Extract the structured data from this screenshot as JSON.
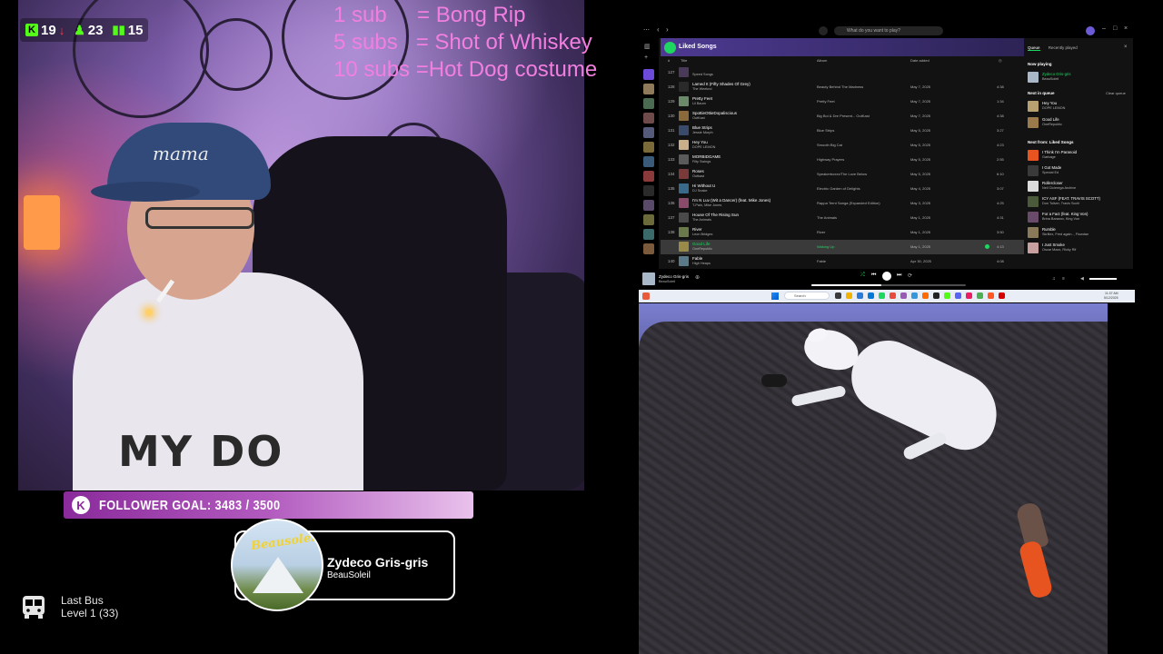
{
  "stats": {
    "kick_label": "K",
    "viewers_trend": "19",
    "followers": "23",
    "bars": "15"
  },
  "sub_goals": [
    {
      "count": "1 sub",
      "reward": "     = Bong Rip"
    },
    {
      "count": "5 subs",
      "reward": "   = Shot of Whiskey"
    },
    {
      "count": "10 subs",
      "reward": " =Hot Dog costume"
    }
  ],
  "follower_goal": {
    "logo": "K",
    "text": "FOLLOWER GOAL: 3483 / 3500",
    "current": 3483,
    "target": 3500
  },
  "now_playing": {
    "album_script": "Beausoleil",
    "title": "Zydeco Gris-gris",
    "artist": "BeauSoleil"
  },
  "last_bus": {
    "title": "Last Bus",
    "level": "Level 1  (33)",
    "icon": "bus-icon"
  },
  "webcam": {
    "cap_text": "mama",
    "shirt_text": "MY DO"
  },
  "spotify": {
    "search_placeholder": "What do you want to play?",
    "playlist_title": "Liked Songs",
    "columns": {
      "num": "#",
      "title": "Title",
      "album": "Album",
      "date": "Date added"
    },
    "rows": [
      {
        "num": "127",
        "title": "",
        "artist": "Speed Songs",
        "album": "",
        "date": "",
        "dur": ""
      },
      {
        "num": "128",
        "title": "Lamed It (Fifty Shades Of Grey)",
        "artist": "The Weeknd",
        "album": "Beauty Behind The Madness",
        "date": "May 7, 2025",
        "dur": "4:38"
      },
      {
        "num": "129",
        "title": "Pretty Feet",
        "artist": "Lil Baum",
        "album": "Pretty Feet",
        "date": "May 7, 2025",
        "dur": "1:34"
      },
      {
        "num": "130",
        "title": "SpottieOttieDopaliscious",
        "artist": "OutKast",
        "album": "Big Boi & Dre Present... OutKast",
        "date": "May 7, 2025",
        "dur": "4:38"
      },
      {
        "num": "131",
        "title": "Blue Strips",
        "artist": "Jessie Murph",
        "album": "Blue Strips",
        "date": "May 5, 2025",
        "dur": "3:27"
      },
      {
        "num": "132",
        "title": "Hey You",
        "artist": "DOPE LEMON",
        "album": "Smooth Big Cat",
        "date": "May 5, 2025",
        "dur": "4:23"
      },
      {
        "num": "133",
        "title": "MORBIDGAME",
        "artist": "Filty Swings",
        "album": "Highway Prayers",
        "date": "May 5, 2025",
        "dur": "2:55"
      },
      {
        "num": "134",
        "title": "Roses",
        "artist": "Outkast",
        "album": "Speakerboxxx/The Love Below",
        "date": "May 5, 2025",
        "dur": "6:10"
      },
      {
        "num": "135",
        "title": "Hi Without U",
        "artist": "DJ Snake",
        "album": "Electric Garden of Delights",
        "date": "May 4, 2025",
        "dur": "3:07"
      },
      {
        "num": "136",
        "title": "I'm N Luv (Wit a Dancer) (feat. Mike Jones)",
        "artist": "T-Pain, Mike Jones",
        "album": "Rappa Ternt Sanga (Expanded Edition)",
        "date": "May 3, 2025",
        "dur": "4:25"
      },
      {
        "num": "137",
        "title": "House Of The Rising Sun",
        "artist": "The Animals",
        "album": "The Animals",
        "date": "May 1, 2025",
        "dur": "4:31"
      },
      {
        "num": "138",
        "title": "River",
        "artist": "Leon Bridges",
        "album": "River",
        "date": "May 1, 2025",
        "dur": "3:50"
      },
      {
        "num": "",
        "title": "Good Life",
        "artist": "OneRepublic",
        "album": "Waking Up",
        "date": "May 1, 2025",
        "dur": "4:13"
      },
      {
        "num": "140",
        "title": "Fable",
        "artist": "High Heaps",
        "album": "Fable",
        "date": "Apr 30, 2025",
        "dur": "4:08"
      },
      {
        "num": "141",
        "title": "Seller Song",
        "artist": "",
        "album": "",
        "date": "",
        "dur": ""
      }
    ],
    "queue": {
      "tabs": [
        "Queue",
        "Recently played"
      ],
      "now_playing_label": "Now playing",
      "now_playing": {
        "title": "Zydeco Gris-gris",
        "artist": "BeauSoleil"
      },
      "next_label": "Next in queue",
      "clear_label": "Clear queue",
      "next": [
        {
          "title": "Hey You",
          "artist": "DOPE LEMON"
        },
        {
          "title": "Good Life",
          "artist": "OneRepublic"
        }
      ],
      "from_label": "Next from: Liked Songs",
      "from": [
        {
          "title": "I Think I'm Paranoid",
          "artist": "Garbage"
        },
        {
          "title": "I Got Made",
          "artist": "Special Ed"
        },
        {
          "title": "Rollercloser",
          "artist": "Neil Cicierega Archive"
        },
        {
          "title": "ICY ASF (FEAT. TRAVIS SCOTT)",
          "artist": "Don Toliver, Travis Scott"
        },
        {
          "title": "For a Fact (feat. King Von)",
          "artist": "Brina Baranov, King Von"
        },
        {
          "title": "Rumble",
          "artist": "Skrillex, Fred again.., Flowdan"
        },
        {
          "title": "I Just Smoke",
          "artist": "Oscar Maxx, Ricky Rif"
        }
      ]
    },
    "player": {
      "title": "Zydeco Gris-gris",
      "artist": "BeauSoleil",
      "progress": 0.45
    }
  },
  "taskbar": {
    "search_label": "Search",
    "clock_time": "11:37 AM",
    "clock_date": "5/12/2025"
  },
  "colors": {
    "goal_text": "#f27fe0",
    "kick_green": "#53fc18",
    "spotify_green": "#1ed760"
  }
}
